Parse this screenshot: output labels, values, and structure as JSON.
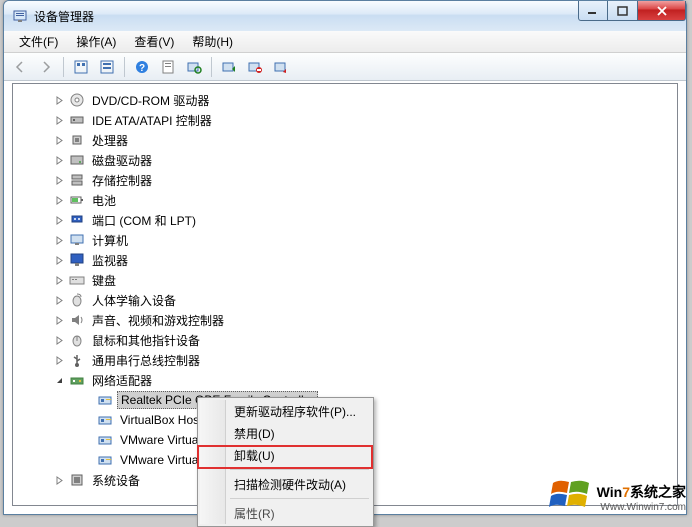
{
  "window": {
    "title": "设备管理器"
  },
  "menu": {
    "file": "文件(F)",
    "action": "操作(A)",
    "view": "查看(V)",
    "help": "帮助(H)"
  },
  "tree": {
    "items": [
      {
        "label": "DVD/CD-ROM 驱动器",
        "icon": "disc"
      },
      {
        "label": "IDE ATA/ATAPI 控制器",
        "icon": "ide"
      },
      {
        "label": "处理器",
        "icon": "cpu"
      },
      {
        "label": "磁盘驱动器",
        "icon": "disk"
      },
      {
        "label": "存储控制器",
        "icon": "storage"
      },
      {
        "label": "电池",
        "icon": "battery"
      },
      {
        "label": "端口 (COM 和 LPT)",
        "icon": "port"
      },
      {
        "label": "计算机",
        "icon": "computer"
      },
      {
        "label": "监视器",
        "icon": "monitor"
      },
      {
        "label": "键盘",
        "icon": "keyboard"
      },
      {
        "label": "人体学输入设备",
        "icon": "hid"
      },
      {
        "label": "声音、视频和游戏控制器",
        "icon": "sound"
      },
      {
        "label": "鼠标和其他指针设备",
        "icon": "mouse"
      },
      {
        "label": "通用串行总线控制器",
        "icon": "usb"
      }
    ],
    "expanded": {
      "label": "网络适配器",
      "children": [
        {
          "label": "Realtek PCIe GBE Family Controller",
          "selected": true
        },
        {
          "label": "VirtualBox Hos"
        },
        {
          "label": "VMware Virtua"
        },
        {
          "label": "VMware Virtua"
        }
      ]
    },
    "last": {
      "label": "系统设备",
      "icon": "system"
    }
  },
  "context": {
    "update": "更新驱动程序软件(P)...",
    "disable": "禁用(D)",
    "uninstall": "卸载(U)",
    "scan": "扫描检测硬件改动(A)",
    "properties": "属性(R)"
  },
  "watermark": {
    "line1a": "Win",
    "line1b": "7",
    "line1c": "系统之家",
    "line2": "Www.Winwin7.com"
  }
}
